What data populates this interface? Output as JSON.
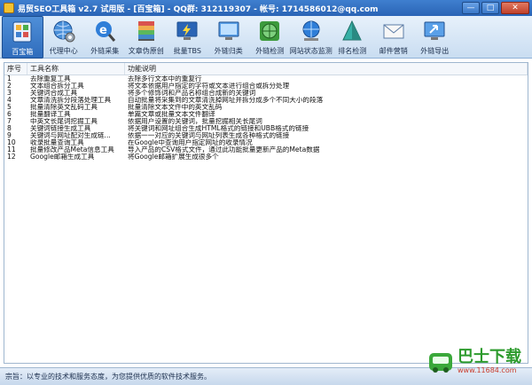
{
  "window": {
    "title": "易贸SEO工具箱 v2.7 试用版 - [百宝箱] - QQ群: 312119307 - 帐号: 1714586012@qq.com",
    "min_label": "—",
    "max_label": "□",
    "close_label": "✕"
  },
  "toolbar": {
    "items": [
      {
        "label": "百宝箱",
        "icon": "toolbox-icon",
        "active": true
      },
      {
        "label": "代理中心",
        "icon": "globe-gear-icon"
      },
      {
        "label": "外链采集",
        "icon": "search-e-icon"
      },
      {
        "label": "文章伪原创",
        "icon": "book-stack-icon"
      },
      {
        "label": "批量TBS",
        "icon": "lightning-monitor-icon"
      },
      {
        "label": "外链归类",
        "icon": "monitor-icon"
      },
      {
        "label": "外链检测",
        "icon": "green-globe-icon"
      },
      {
        "label": "网站状态监测",
        "icon": "globe-network-icon"
      },
      {
        "label": "排名检测",
        "icon": "pyramid-icon"
      },
      {
        "label": "邮件营销",
        "icon": "envelope-icon"
      },
      {
        "label": "外链导出",
        "icon": "monitor-export-icon"
      }
    ]
  },
  "table": {
    "columns": [
      "序号",
      "工具名称",
      "功能说明"
    ],
    "rows": [
      [
        "1",
        "去除重复工具",
        "去除多行文本中的重复行"
      ],
      [
        "2",
        "文本组合拆分工具",
        "将文本依据用户指定的字符或文本进行组合或拆分处理"
      ],
      [
        "3",
        "关键词合成工具",
        "将多个修饰词和产品名称组合成新的关键词"
      ],
      [
        "4",
        "文章清洗拆分段落处理工具",
        "自动批量将采集到的文章清洗掉网址并拆分成多个不同大小的段落"
      ],
      [
        "5",
        "批量清除英文乱码工具",
        "批量清除文本文件中的英文乱码"
      ],
      [
        "6",
        "批量翻译工具",
        "单篇文章或批量文本文件翻译"
      ],
      [
        "7",
        "中英文长尾词挖掘工具",
        "依据用户设置的关键词，批量挖掘相关长尾词"
      ],
      [
        "8",
        "关键词链接生成工具",
        "将关键词和网址组合生成HTML格式的链接和UBB格式的链接"
      ],
      [
        "9",
        "关键词与网址配对生成链...",
        "依据一一对应的关键词与网址列表生成各种格式的链接"
      ],
      [
        "10",
        "收录批量查询工具",
        "在Google中查询用户指定网址的收录情况"
      ],
      [
        "11",
        "批量修改产品Meta信息工具",
        "导入产品的CSV格式文件，通过此功能批量更新产品的Meta数据"
      ],
      [
        "12",
        "Google邮箱生成工具",
        "将Google邮箱扩展生成很多个"
      ]
    ]
  },
  "statusbar": {
    "text": "宗旨：以专业的技术和服务态度，为您提供优质的软件技术服务。"
  },
  "watermark": {
    "brand": "巴士下载",
    "url": "www.11684.com"
  }
}
